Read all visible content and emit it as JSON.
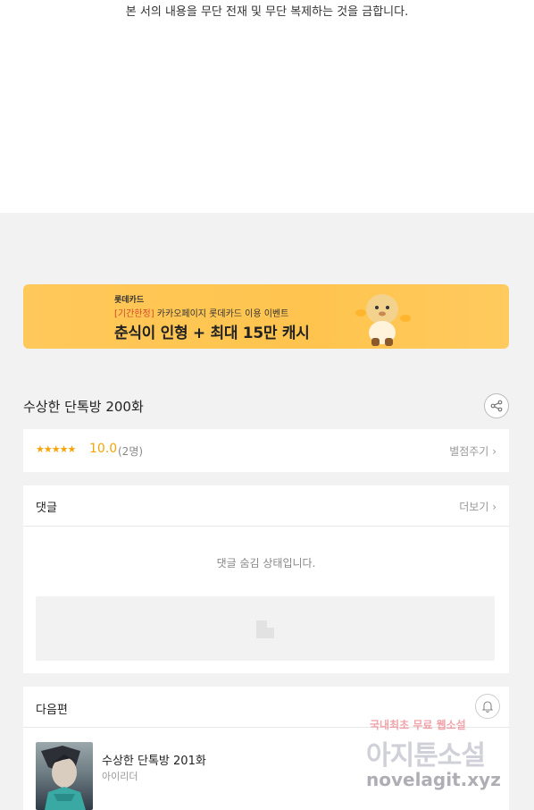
{
  "copyright": "본 서의 내용을 무단 전재 및 무단 복제하는 것을 금합니다.",
  "banner": {
    "brand": "롯데카드",
    "sub_tag": "[기간한정]",
    "sub_text": " 카카오페이지 롯데카드 이용 이벤트",
    "headline": "춘식이 인형 + 최대 15만 캐시"
  },
  "episode": {
    "title": "수상한 단톡방 200화",
    "share_icon": "share-icon"
  },
  "rating": {
    "stars": "★★★★★",
    "score": "10.0",
    "count": "(2명)",
    "rate_label": "별점주기",
    "chevron": "›"
  },
  "comments": {
    "title": "댓글",
    "more_label": "더보기",
    "chevron": "›",
    "hidden_message": "댓글 숨김 상태입니다."
  },
  "next": {
    "title": "다음편",
    "episode_title": "수상한 단톡방 201화",
    "author": "아이리더",
    "bell_icon": "bell-icon"
  },
  "watermark": {
    "line1": "국내최초 무료 웹소설",
    "line2": "아지툰소설",
    "line3": "novelagit.xyz"
  },
  "colors": {
    "banner_bg": "#ffc44e",
    "star": "#f5a40a",
    "page_bg": "#f2f2f2"
  }
}
